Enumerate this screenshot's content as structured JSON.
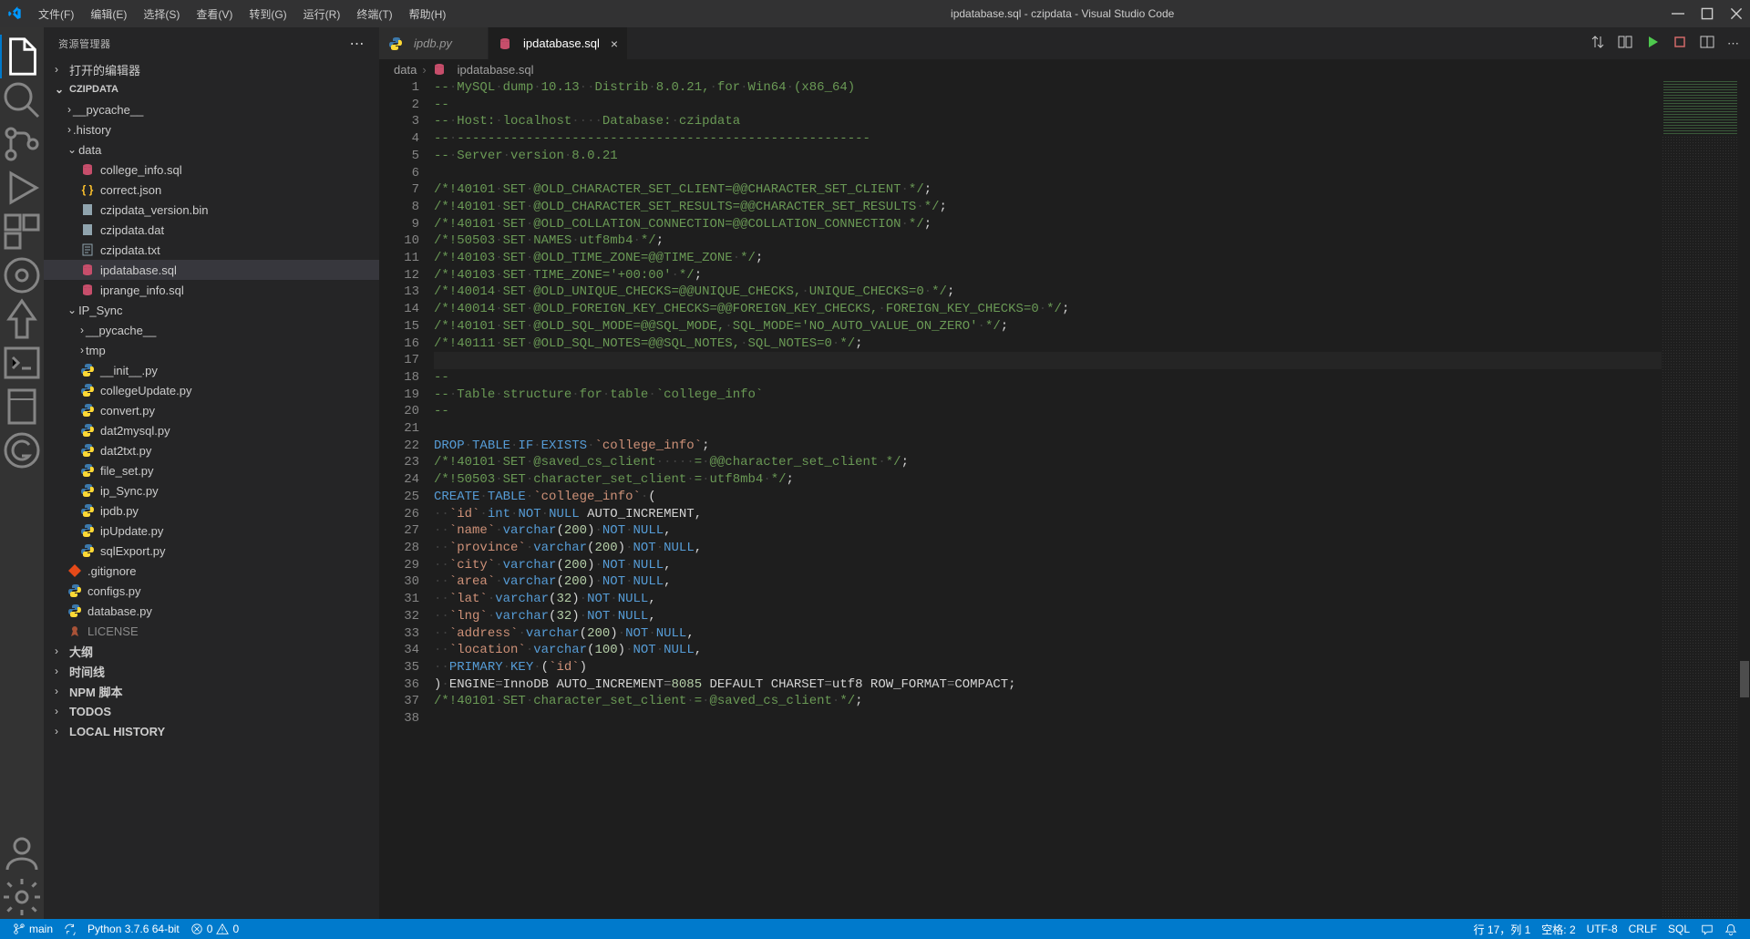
{
  "window": {
    "title": "ipdatabase.sql - czipdata - Visual Studio Code"
  },
  "menu": [
    "文件(F)",
    "编辑(E)",
    "选择(S)",
    "查看(V)",
    "转到(G)",
    "运行(R)",
    "终端(T)",
    "帮助(H)"
  ],
  "sidebar": {
    "title": "资源管理器",
    "sections": {
      "open_editors": "打开的编辑器",
      "project": "CZIPDATA",
      "outline": "大纲",
      "timeline": "时间线",
      "npm": "NPM 脚本",
      "todos": "TODOS",
      "local_history": "LOCAL HISTORY"
    },
    "tree": [
      {
        "type": "folder",
        "name": "__pycache__",
        "indent": 1,
        "expanded": false
      },
      {
        "type": "folder",
        "name": ".history",
        "indent": 1,
        "expanded": false
      },
      {
        "type": "folder",
        "name": "data",
        "indent": 1,
        "expanded": true
      },
      {
        "type": "file",
        "name": "college_info.sql",
        "indent": 2,
        "icon": "db"
      },
      {
        "type": "file",
        "name": "correct.json",
        "indent": 2,
        "icon": "json"
      },
      {
        "type": "file",
        "name": "czipdata_version.bin",
        "indent": 2,
        "icon": "bin"
      },
      {
        "type": "file",
        "name": "czipdata.dat",
        "indent": 2,
        "icon": "bin"
      },
      {
        "type": "file",
        "name": "czipdata.txt",
        "indent": 2,
        "icon": "txt"
      },
      {
        "type": "file",
        "name": "ipdatabase.sql",
        "indent": 2,
        "icon": "db",
        "selected": true
      },
      {
        "type": "file",
        "name": "iprange_info.sql",
        "indent": 2,
        "icon": "db"
      },
      {
        "type": "folder",
        "name": "IP_Sync",
        "indent": 1,
        "expanded": true
      },
      {
        "type": "folder",
        "name": "__pycache__",
        "indent": 2,
        "expanded": false
      },
      {
        "type": "folder",
        "name": "tmp",
        "indent": 2,
        "expanded": false
      },
      {
        "type": "file",
        "name": "__init__.py",
        "indent": 2,
        "icon": "py"
      },
      {
        "type": "file",
        "name": "collegeUpdate.py",
        "indent": 2,
        "icon": "py"
      },
      {
        "type": "file",
        "name": "convert.py",
        "indent": 2,
        "icon": "py"
      },
      {
        "type": "file",
        "name": "dat2mysql.py",
        "indent": 2,
        "icon": "py"
      },
      {
        "type": "file",
        "name": "dat2txt.py",
        "indent": 2,
        "icon": "py"
      },
      {
        "type": "file",
        "name": "file_set.py",
        "indent": 2,
        "icon": "py"
      },
      {
        "type": "file",
        "name": "ip_Sync.py",
        "indent": 2,
        "icon": "py"
      },
      {
        "type": "file",
        "name": "ipdb.py",
        "indent": 2,
        "icon": "py"
      },
      {
        "type": "file",
        "name": "ipUpdate.py",
        "indent": 2,
        "icon": "py"
      },
      {
        "type": "file",
        "name": "sqlExport.py",
        "indent": 2,
        "icon": "py"
      },
      {
        "type": "file",
        "name": ".gitignore",
        "indent": 1,
        "icon": "git"
      },
      {
        "type": "file",
        "name": "configs.py",
        "indent": 1,
        "icon": "py"
      },
      {
        "type": "file",
        "name": "database.py",
        "indent": 1,
        "icon": "py"
      },
      {
        "type": "file",
        "name": "LICENSE",
        "indent": 1,
        "icon": "lic",
        "dim": true
      }
    ]
  },
  "tabs": [
    {
      "label": "ipdb.py",
      "icon": "py",
      "active": false,
      "italic": true
    },
    {
      "label": "ipdatabase.sql",
      "icon": "db",
      "active": true,
      "close": true
    }
  ],
  "breadcrumb": [
    "data",
    "ipdatabase.sql"
  ],
  "code_lines": [
    {
      "n": 1,
      "html": "<span class='comment'>--<span class='dot'>·</span>MySQL<span class='dot'>·</span>dump<span class='dot'>·</span>10.13<span class='dot'>··</span>Distrib<span class='dot'>·</span>8.0.21,<span class='dot'>·</span>for<span class='dot'>·</span>Win64<span class='dot'>·</span>(x86_64)</span>"
    },
    {
      "n": 2,
      "html": "<span class='comment'>--</span>"
    },
    {
      "n": 3,
      "html": "<span class='comment'>--<span class='dot'>·</span>Host:<span class='dot'>·</span>localhost<span class='dot'>····</span>Database:<span class='dot'>·</span>czipdata</span>"
    },
    {
      "n": 4,
      "html": "<span class='comment'>--<span class='dot'>·</span>------------------------------------------------------</span>"
    },
    {
      "n": 5,
      "html": "<span class='comment'>--<span class='dot'>·</span>Server<span class='dot'>·</span>version<span class='dot'>·</span>8.0.21</span>"
    },
    {
      "n": 6,
      "html": ""
    },
    {
      "n": 7,
      "html": "<span class='comment'>/*!40101<span class='dot'>·</span>SET<span class='dot'>·</span>@OLD_CHARACTER_SET_CLIENT=@@CHARACTER_SET_CLIENT<span class='dot'>·</span>*/</span>;"
    },
    {
      "n": 8,
      "html": "<span class='comment'>/*!40101<span class='dot'>·</span>SET<span class='dot'>·</span>@OLD_CHARACTER_SET_RESULTS=@@CHARACTER_SET_RESULTS<span class='dot'>·</span>*/</span>;"
    },
    {
      "n": 9,
      "html": "<span class='comment'>/*!40101<span class='dot'>·</span>SET<span class='dot'>·</span>@OLD_COLLATION_CONNECTION=@@COLLATION_CONNECTION<span class='dot'>·</span>*/</span>;"
    },
    {
      "n": 10,
      "html": "<span class='comment'>/*!50503<span class='dot'>·</span>SET<span class='dot'>·</span>NAMES<span class='dot'>·</span>utf8mb4<span class='dot'>·</span>*/</span>;"
    },
    {
      "n": 11,
      "html": "<span class='comment'>/*!40103<span class='dot'>·</span>SET<span class='dot'>·</span>@OLD_TIME_ZONE=@@TIME_ZONE<span class='dot'>·</span>*/</span>;"
    },
    {
      "n": 12,
      "html": "<span class='comment'>/*!40103<span class='dot'>·</span>SET<span class='dot'>·</span>TIME_ZONE='+00:00'<span class='dot'>·</span>*/</span>;"
    },
    {
      "n": 13,
      "html": "<span class='comment'>/*!40014<span class='dot'>·</span>SET<span class='dot'>·</span>@OLD_UNIQUE_CHECKS=@@UNIQUE_CHECKS,<span class='dot'>·</span>UNIQUE_CHECKS=0<span class='dot'>·</span>*/</span>;"
    },
    {
      "n": 14,
      "html": "<span class='comment'>/*!40014<span class='dot'>·</span>SET<span class='dot'>·</span>@OLD_FOREIGN_KEY_CHECKS=@@FOREIGN_KEY_CHECKS,<span class='dot'>·</span>FOREIGN_KEY_CHECKS=0<span class='dot'>·</span>*/</span>;"
    },
    {
      "n": 15,
      "html": "<span class='comment'>/*!40101<span class='dot'>·</span>SET<span class='dot'>·</span>@OLD_SQL_MODE=@@SQL_MODE,<span class='dot'>·</span>SQL_MODE='NO_AUTO_VALUE_ON_ZERO'<span class='dot'>·</span>*/</span>;"
    },
    {
      "n": 16,
      "html": "<span class='comment'>/*!40111<span class='dot'>·</span>SET<span class='dot'>·</span>@OLD_SQL_NOTES=@@SQL_NOTES,<span class='dot'>·</span>SQL_NOTES=0<span class='dot'>·</span>*/</span>;"
    },
    {
      "n": 17,
      "html": "",
      "cursor": true
    },
    {
      "n": 18,
      "html": "<span class='comment'>--</span>"
    },
    {
      "n": 19,
      "html": "<span class='comment'>--<span class='dot'>·</span>Table<span class='dot'>·</span>structure<span class='dot'>·</span>for<span class='dot'>·</span>table<span class='dot'>·</span>`college_info`</span>"
    },
    {
      "n": 20,
      "html": "<span class='comment'>--</span>"
    },
    {
      "n": 21,
      "html": ""
    },
    {
      "n": 22,
      "html": "<span class='kw'>DROP</span><span class='dot'>·</span><span class='kw'>TABLE</span><span class='dot'>·</span><span class='kw'>IF</span><span class='dot'>·</span><span class='kw'>EXISTS</span><span class='dot'>·</span><span class='str'>`college_info`</span>;"
    },
    {
      "n": 23,
      "html": "<span class='comment'>/*!40101<span class='dot'>·</span>SET<span class='dot'>·</span>@saved_cs_client<span class='dot'>·····</span>=<span class='dot'>·</span>@@character_set_client<span class='dot'>·</span>*/</span>;"
    },
    {
      "n": 24,
      "html": "<span class='comment'>/*!50503<span class='dot'>·</span>SET<span class='dot'>·</span>character_set_client<span class='dot'>·</span>=<span class='dot'>·</span>utf8mb4<span class='dot'>·</span>*/</span>;"
    },
    {
      "n": 25,
      "html": "<span class='kw'>CREATE</span><span class='dot'>·</span><span class='kw'>TABLE</span><span class='dot'>·</span><span class='str'>`college_info`</span><span class='dot'>·</span>("
    },
    {
      "n": 26,
      "html": "<span class='dot'>··</span><span class='str'>`id`</span><span class='dot'>·</span><span class='kw'>int</span><span class='dot'>·</span><span class='kw'>NOT</span><span class='dot'>·</span><span class='kw'>NULL</span> AUTO_INCREMENT,"
    },
    {
      "n": 27,
      "html": "<span class='dot'>··</span><span class='str'>`name`</span><span class='dot'>·</span><span class='kw'>varchar</span>(<span class='num'>200</span>)<span class='dot'>·</span><span class='kw'>NOT</span><span class='dot'>·</span><span class='kw'>NULL</span>,"
    },
    {
      "n": 28,
      "html": "<span class='dot'>··</span><span class='str'>`province`</span><span class='dot'>·</span><span class='kw'>varchar</span>(<span class='num'>200</span>)<span class='dot'>·</span><span class='kw'>NOT</span><span class='dot'>·</span><span class='kw'>NULL</span>,"
    },
    {
      "n": 29,
      "html": "<span class='dot'>··</span><span class='str'>`city`</span><span class='dot'>·</span><span class='kw'>varchar</span>(<span class='num'>200</span>)<span class='dot'>·</span><span class='kw'>NOT</span><span class='dot'>·</span><span class='kw'>NULL</span>,"
    },
    {
      "n": 30,
      "html": "<span class='dot'>··</span><span class='str'>`area`</span><span class='dot'>·</span><span class='kw'>varchar</span>(<span class='num'>200</span>)<span class='dot'>·</span><span class='kw'>NOT</span><span class='dot'>·</span><span class='kw'>NULL</span>,"
    },
    {
      "n": 31,
      "html": "<span class='dot'>··</span><span class='str'>`lat`</span><span class='dot'>·</span><span class='kw'>varchar</span>(<span class='num'>32</span>)<span class='dot'>·</span><span class='kw'>NOT</span><span class='dot'>·</span><span class='kw'>NULL</span>,"
    },
    {
      "n": 32,
      "html": "<span class='dot'>··</span><span class='str'>`lng`</span><span class='dot'>·</span><span class='kw'>varchar</span>(<span class='num'>32</span>)<span class='dot'>·</span><span class='kw'>NOT</span><span class='dot'>·</span><span class='kw'>NULL</span>,"
    },
    {
      "n": 33,
      "html": "<span class='dot'>··</span><span class='str'>`address`</span><span class='dot'>·</span><span class='kw'>varchar</span>(<span class='num'>200</span>)<span class='dot'>·</span><span class='kw'>NOT</span><span class='dot'>·</span><span class='kw'>NULL</span>,"
    },
    {
      "n": 34,
      "html": "<span class='dot'>··</span><span class='str'>`location`</span><span class='dot'>·</span><span class='kw'>varchar</span>(<span class='num'>100</span>)<span class='dot'>·</span><span class='kw'>NOT</span><span class='dot'>·</span><span class='kw'>NULL</span>,"
    },
    {
      "n": 35,
      "html": "<span class='dot'>··</span><span class='kw'>PRIMARY</span><span class='dot'>·</span><span class='kw'>KEY</span><span class='dot'>·</span>(<span class='str'>`id`</span>)"
    },
    {
      "n": 36,
      "html": ")<span class='dot'>·</span>ENGINE<span class='grey'>=</span>InnoDB AUTO_INCREMENT<span class='grey'>=</span><span class='num'>8085</span> DEFAULT CHARSET<span class='grey'>=</span>utf8 ROW_FORMAT<span class='grey'>=</span>COMPACT;"
    },
    {
      "n": 37,
      "html": "<span class='comment'>/*!40101<span class='dot'>·</span>SET<span class='dot'>·</span>character_set_client<span class='dot'>·</span>=<span class='dot'>·</span>@saved_cs_client<span class='dot'>·</span>*/</span>;"
    },
    {
      "n": 38,
      "html": ""
    }
  ],
  "status": {
    "branch": "main",
    "python": "Python 3.7.6 64-bit",
    "errors": "0",
    "warnings": "0",
    "line_col": "行 17，列 1",
    "spaces": "空格: 2",
    "encoding": "UTF-8",
    "eol": "CRLF",
    "lang": "SQL"
  }
}
